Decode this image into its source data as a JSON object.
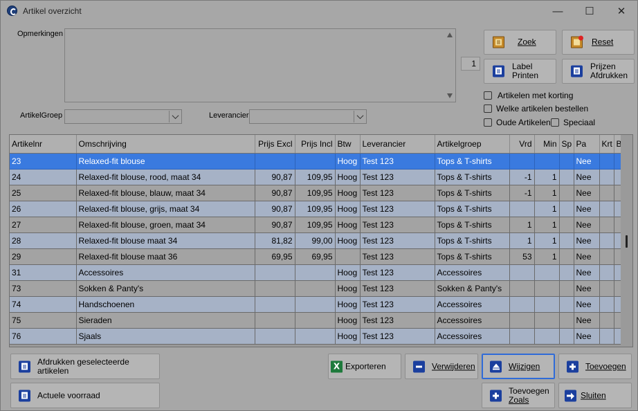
{
  "window": {
    "title": "Artikel overzicht",
    "controls": {
      "minimize": "—",
      "maximize": "☐",
      "close": "✕"
    }
  },
  "filters": {
    "opmerkingen_label": "Opmerkingen",
    "opmerkingen_value": "",
    "artikelgroep_label": "ArtikelGroep",
    "artikelgroep_value": "",
    "leverancier_label": "Leverancier",
    "leverancier_value": "",
    "counter": "1"
  },
  "buttons": {
    "zoek": "Zoek",
    "reset": "Reset",
    "label_printen_1": "Label",
    "label_printen_2": "Printen",
    "prijzen_afdrukken_1": "Prijzen",
    "prijzen_afdrukken_2": "Afdrukken",
    "afdrukken_geselecteerde": "Afdrukken geselecteerde artikelen",
    "actuele_voorraad": "Actuele voorraad",
    "exporteren": "Exporteren",
    "verwijderen": "Verwijderen",
    "wijzigen": "Wijzigen",
    "toevoegen": "Toevoegen",
    "toevoegen_zoals_1": "Toevoegen",
    "toevoegen_zoals_2": "Zoals",
    "sluiten": "Sluiten"
  },
  "checkboxes": {
    "artikelen_met_korting": "Artikelen met korting",
    "welke_artikelen_bestellen": "Welke artikelen bestellen",
    "oude_artikelen": "Oude Artikelen",
    "speciaal": "Speciaal"
  },
  "grid": {
    "columns": [
      "Artikelnr",
      "Omschrijving",
      "Prijs Excl",
      "Prijs Incl",
      "Btw",
      "Leverancier",
      "Artikelgroep",
      "Vrd",
      "Min",
      "Sp",
      "Pa",
      "Krt",
      "B"
    ],
    "rows": [
      [
        "23",
        "Relaxed-fit blouse",
        "",
        "",
        "Hoog",
        "Test 123",
        "Tops & T-shirts",
        "",
        "",
        "",
        "Nee",
        "",
        ""
      ],
      [
        "24",
        "Relaxed-fit blouse, rood, maat 34",
        "90,87",
        "109,95",
        "Hoog",
        "Test 123",
        "Tops & T-shirts",
        "-1",
        "1",
        "",
        "Nee",
        "",
        ""
      ],
      [
        "25",
        "Relaxed-fit blouse, blauw, maat 34",
        "90,87",
        "109,95",
        "Hoog",
        "Test 123",
        "Tops & T-shirts",
        "-1",
        "1",
        "",
        "Nee",
        "",
        ""
      ],
      [
        "26",
        "Relaxed-fit blouse, grijs, maat 34",
        "90,87",
        "109,95",
        "Hoog",
        "Test 123",
        "Tops & T-shirts",
        "",
        "1",
        "",
        "Nee",
        "",
        ""
      ],
      [
        "27",
        "Relaxed-fit blouse, groen, maat 34",
        "90,87",
        "109,95",
        "Hoog",
        "Test 123",
        "Tops & T-shirts",
        "1",
        "1",
        "",
        "Nee",
        "",
        ""
      ],
      [
        "28",
        "Relaxed-fit blouse maat 34",
        "81,82",
        "99,00",
        "Hoog",
        "Test 123",
        "Tops & T-shirts",
        "1",
        "1",
        "",
        "Nee",
        "",
        ""
      ],
      [
        "29",
        "Relaxed-fit blouse maat 36",
        "69,95",
        "69,95",
        "",
        "Test 123",
        "Tops & T-shirts",
        "53",
        "1",
        "",
        "Nee",
        "",
        ""
      ],
      [
        "31",
        "Accessoires",
        "",
        "",
        "Hoog",
        "Test 123",
        "Accessoires",
        "",
        "",
        "",
        "Nee",
        "",
        ""
      ],
      [
        "73",
        "Sokken & Panty's",
        "",
        "",
        "Hoog",
        "Test 123",
        "Sokken & Panty's",
        "",
        "",
        "",
        "Nee",
        "",
        ""
      ],
      [
        "74",
        "Handschoenen",
        "",
        "",
        "Hoog",
        "Test 123",
        "Accessoires",
        "",
        "",
        "",
        "Nee",
        "",
        ""
      ],
      [
        "75",
        "Sieraden",
        "",
        "",
        "Hoog",
        "Test 123",
        "Accessoires",
        "",
        "",
        "",
        "Nee",
        "",
        ""
      ],
      [
        "76",
        "Sjaals",
        "",
        "",
        "Hoog",
        "Test 123",
        "Accessoires",
        "",
        "",
        "",
        "Nee",
        "",
        ""
      ]
    ],
    "selected_row": 0
  },
  "colors": {
    "window_bg": "#a7a7a7",
    "row_alt": "#a6b2c6",
    "row_selected": "#3a7adf",
    "icon_blue": "#1b3f9e"
  }
}
